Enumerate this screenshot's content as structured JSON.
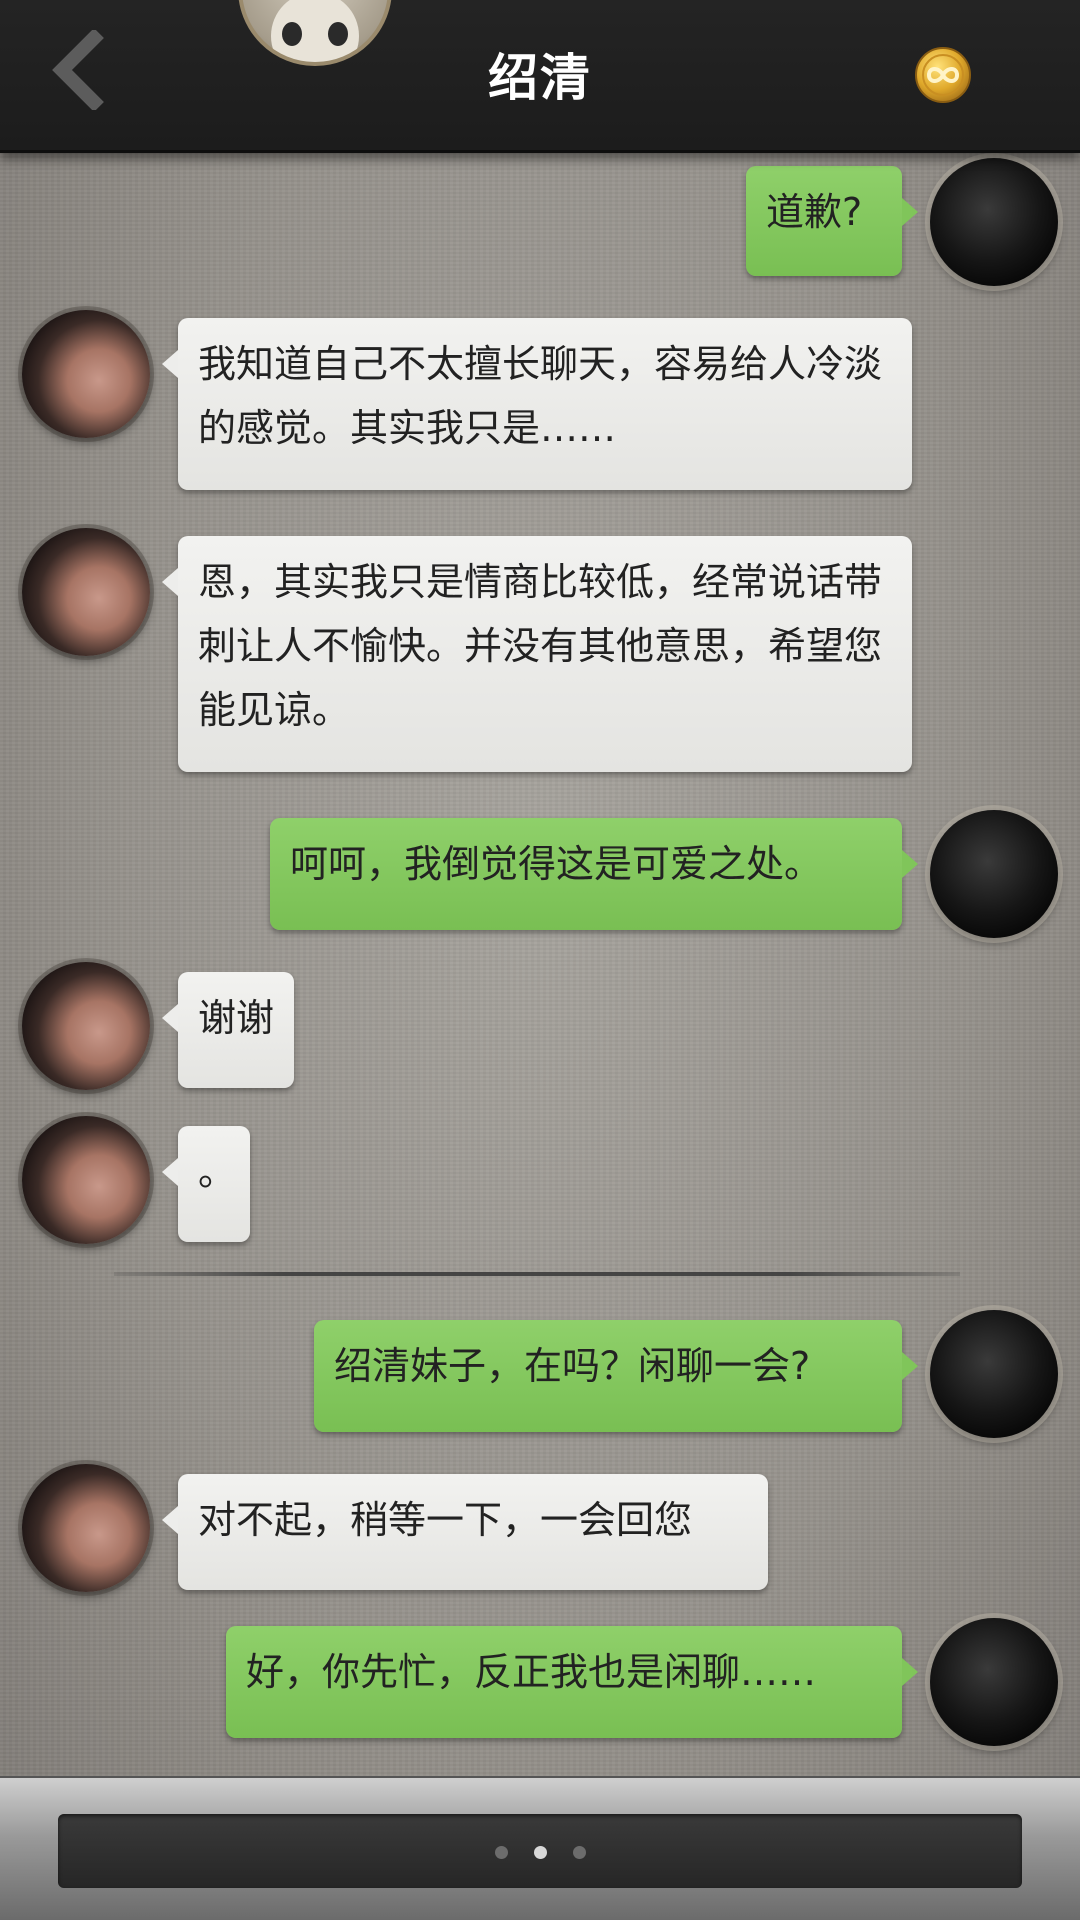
{
  "header": {
    "title": "绍清",
    "back_icon": "chevron-left-icon",
    "coin_icon": "infinity-coin-icon"
  },
  "messages": [
    {
      "sender": "me",
      "text": "道歉?"
    },
    {
      "sender": "her",
      "text": "我知道自己不太擅长聊天，容易给人冷淡的感觉。其实我只是……"
    },
    {
      "sender": "her",
      "text": "恩，其实我只是情商比较低，经常说话带刺让人不愉快。并没有其他意思，希望您能见谅。"
    },
    {
      "sender": "me",
      "text": "呵呵，我倒觉得这是可爱之处。"
    },
    {
      "sender": "her",
      "text": "谢谢"
    },
    {
      "sender": "her",
      "text": "。"
    },
    {
      "sender": "me",
      "text": "绍清妹子，在吗？闲聊一会?"
    },
    {
      "sender": "her",
      "text": "对不起，稍等一下，一会回您"
    },
    {
      "sender": "me",
      "text": "好，你先忙，反正我也是闲聊……"
    }
  ],
  "pager": {
    "count": 3,
    "active_index": 1
  },
  "colors": {
    "header_bg": "#1f1f1f",
    "my_bubble": "#7fc459",
    "her_bubble": "#ececea",
    "coin": "#e3b53a"
  }
}
